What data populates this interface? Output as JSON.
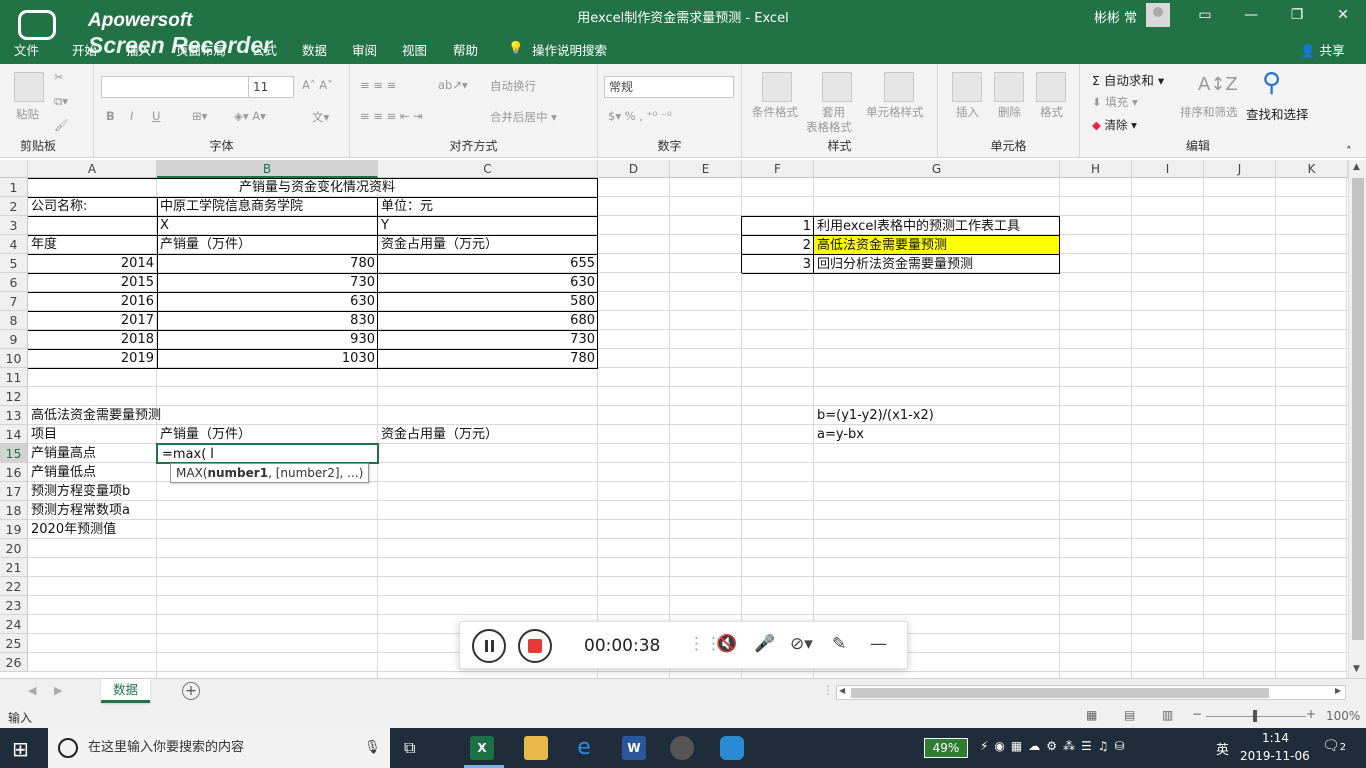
{
  "window": {
    "title": "用excel制作资金需求量预测  -  Excel",
    "user": "彬彬 常"
  },
  "watermark": {
    "line1": "Apowersoft",
    "line2": "Screen Recorder Pro"
  },
  "menu": {
    "file": "文件",
    "home": "开始",
    "insert": "插入",
    "layout": "页面布局",
    "formulas": "公式",
    "data": "数据",
    "review": "审阅",
    "view": "视图",
    "help": "帮助",
    "tellme": "操作说明搜索",
    "share": "共享"
  },
  "ribbon": {
    "clipboard": {
      "label": "剪贴板",
      "paste": "粘贴"
    },
    "font": {
      "label": "字体",
      "name": "",
      "size": "11",
      "bold": "B",
      "italic": "I",
      "underline": "U"
    },
    "align": {
      "label": "对齐方式",
      "wrap": "自动换行",
      "merge": "合并后居中"
    },
    "number": {
      "label": "数字",
      "format": "常规"
    },
    "styles": {
      "label": "样式",
      "cond": "条件格式",
      "table1": "套用",
      "table2": "表格格式",
      "cell": "单元格样式"
    },
    "cells": {
      "label": "单元格",
      "insert": "插入",
      "delete": "删除",
      "format": "格式"
    },
    "edit": {
      "label": "编辑",
      "autosum": "自动求和",
      "fill": "填充",
      "clear": "清除",
      "sortfilter": "排序和筛选",
      "find": "查找和选择"
    }
  },
  "columns": [
    "A",
    "B",
    "C",
    "D",
    "E",
    "F",
    "G",
    "H",
    "I",
    "J",
    "K"
  ],
  "rows": [
    "1",
    "2",
    "3",
    "4",
    "5",
    "6",
    "7",
    "8",
    "9",
    "10",
    "11",
    "12",
    "13",
    "14",
    "15",
    "16",
    "17",
    "18",
    "19",
    "20",
    "21",
    "22",
    "23",
    "24",
    "25",
    "26"
  ],
  "sheet": {
    "title": "产销量与资金变化情况资料",
    "company_label": "公司名称:",
    "company": "中原工学院信息商务学院",
    "unit": "单位：元",
    "x": "X",
    "y": "Y",
    "year_h": "年度",
    "qty_h": "产销量（万件）",
    "fund_h": "资金占用量（万元）",
    "data": [
      {
        "year": "2014",
        "qty": "780",
        "fund": "655"
      },
      {
        "year": "2015",
        "qty": "730",
        "fund": "630"
      },
      {
        "year": "2016",
        "qty": "630",
        "fund": "580"
      },
      {
        "year": "2017",
        "qty": "830",
        "fund": "680"
      },
      {
        "year": "2018",
        "qty": "930",
        "fund": "730"
      },
      {
        "year": "2019",
        "qty": "1030",
        "fund": "780"
      }
    ],
    "menu_items": [
      {
        "n": "1",
        "t": "利用excel表格中的预测工作表工具"
      },
      {
        "n": "2",
        "t": "高低法资金需要量预测"
      },
      {
        "n": "3",
        "t": "回归分析法资金需要量预测"
      }
    ],
    "highlight": "#ffff00",
    "section_title": "高低法资金需要量预测",
    "item_h": "项目",
    "qty_h2": "产销量（万件）",
    "fund_h2": "资金占用量（万元）",
    "labels": [
      "产销量高点",
      "产销量低点",
      "预测方程变量项b",
      "预测方程常数项a",
      "2020年预测值"
    ],
    "formula_b": "b=(y1-y2)/(x1-x2)",
    "formula_a": "a=y-bx",
    "editing": "=max(",
    "tooltip_fn": "MAX(",
    "tooltip_arg1": "number1",
    "tooltip_rest": ", [number2], ...)"
  },
  "tabs": {
    "sheet": "数据"
  },
  "status": {
    "mode": "输入",
    "zoom": "100%"
  },
  "recorder": {
    "time": "00:00:38"
  },
  "taskbar": {
    "search": "在这里输入你要搜索的内容",
    "battery": "49%",
    "ime": "英",
    "time": "1:14",
    "date": "2019-11-06",
    "notif": "2"
  },
  "colors": {
    "accent": "#217346"
  }
}
